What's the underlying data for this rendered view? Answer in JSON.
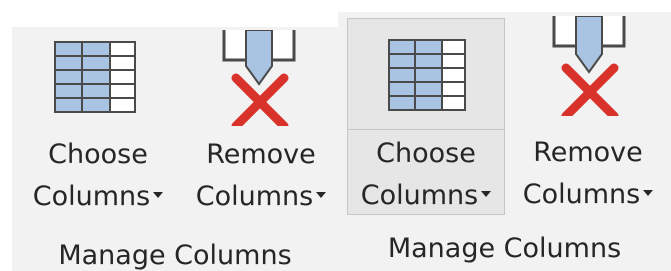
{
  "left_panel": {
    "choose_columns": {
      "line1": "Choose",
      "line2": "Columns",
      "icon": "table-columns-icon"
    },
    "remove_columns": {
      "line1": "Remove",
      "line2": "Columns",
      "icon": "remove-columns-icon"
    },
    "group_label": "Manage Columns"
  },
  "right_panel": {
    "choose_columns": {
      "line1": "Choose",
      "line2": "Columns",
      "icon": "table-columns-icon",
      "state": "hover"
    },
    "remove_columns": {
      "line1": "Remove",
      "line2": "Columns",
      "icon": "remove-columns-icon"
    },
    "group_label": "Manage Columns"
  },
  "colors": {
    "panel_background": "#f2f2f2",
    "hover_background": "#e6e6e6",
    "hover_border": "#c6c6c6",
    "table_blue": "#a9c3e2",
    "table_border": "#4a4a4a",
    "remove_x_red": "#d9322b",
    "text": "#262626"
  }
}
